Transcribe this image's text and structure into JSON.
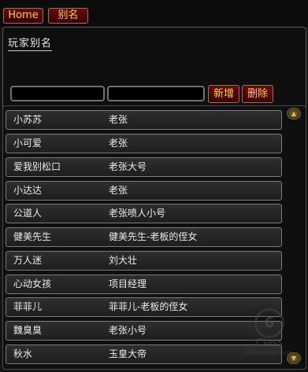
{
  "tabs": {
    "home": "Home",
    "alias": "别名"
  },
  "section_label": "玩家别名",
  "inputs": {
    "name_value": "",
    "alias_value": ""
  },
  "buttons": {
    "add": "新增",
    "delete": "删除"
  },
  "rows": [
    {
      "name": "小苏苏",
      "alias": "老张"
    },
    {
      "name": "小可爱",
      "alias": "老张"
    },
    {
      "name": "爱我别松口",
      "alias": "老张大号"
    },
    {
      "name": "小达达",
      "alias": "老张"
    },
    {
      "name": "公道人",
      "alias": "老张喷人小号"
    },
    {
      "name": "健美先生",
      "alias": "健美先生-老板的侄女"
    },
    {
      "name": "万人迷",
      "alias": "刘大壮"
    },
    {
      "name": "心动女孩",
      "alias": "项目经理"
    },
    {
      "name": "菲菲儿",
      "alias": "菲菲儿-老板的侄女"
    },
    {
      "name": "魏臭臭",
      "alias": "老张小号"
    },
    {
      "name": "秋水",
      "alias": "玉皇大帝"
    }
  ],
  "scroll": {
    "up_icon": "▲",
    "down_icon": "▼"
  },
  "watermark": {
    "brand": "Class",
    "site": "60addons.com"
  }
}
